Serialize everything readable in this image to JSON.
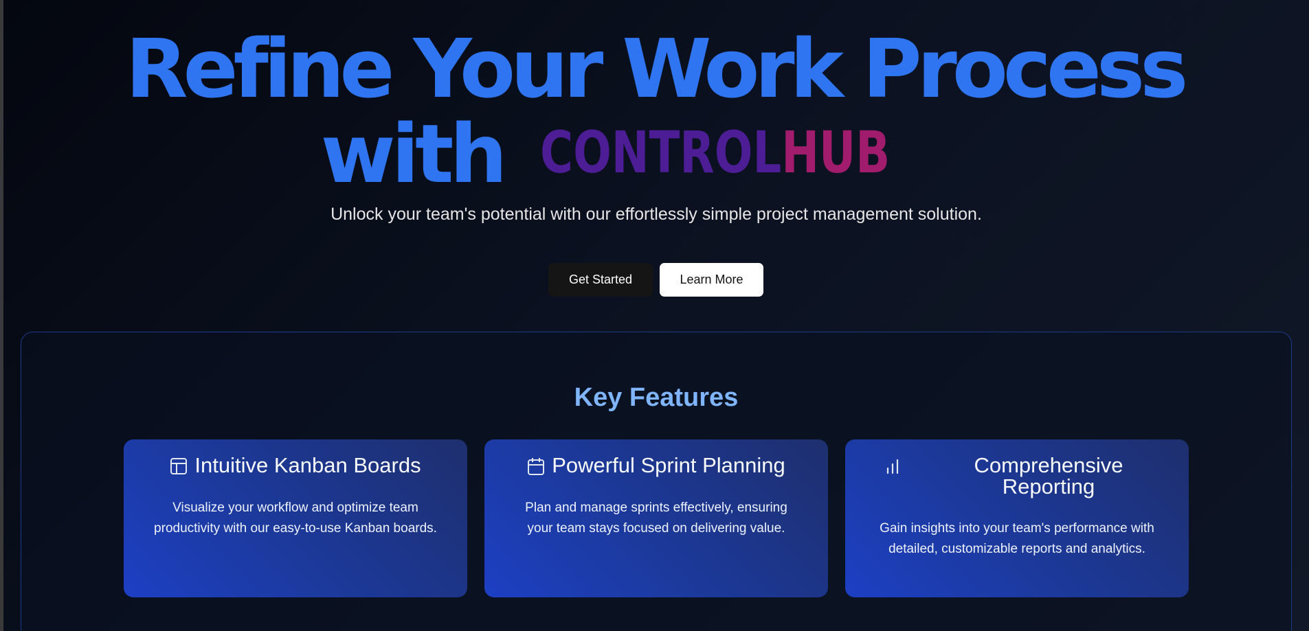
{
  "hero": {
    "title_line1": "Refine Your Work Process",
    "title_with": "with",
    "brand_part1": "CONTROL",
    "brand_part2": "HUB",
    "subtitle": "Unlock your team's potential with our effortlessly simple project management solution."
  },
  "actions": {
    "get_started": "Get Started",
    "learn_more": "Learn More"
  },
  "features": {
    "title": "Key Features",
    "cards": [
      {
        "icon": "layout-icon",
        "title": "Intuitive Kanban Boards",
        "description": "Visualize your workflow and optimize team productivity with our easy-to-use Kanban boards."
      },
      {
        "icon": "calendar-icon",
        "title": "Powerful Sprint Planning",
        "description": "Plan and manage sprints effectively, ensuring your team stays focused on delivering value."
      },
      {
        "icon": "bar-chart-icon",
        "title": "Comprehensive Reporting",
        "description": "Gain insights into your team's performance with detailed, customizable reports and analytics."
      }
    ]
  },
  "colors": {
    "accent_blue": "#2f74f0",
    "brand_purple": "#4c1d95",
    "brand_magenta": "#a21c6e",
    "features_title": "#7fb4ff"
  }
}
